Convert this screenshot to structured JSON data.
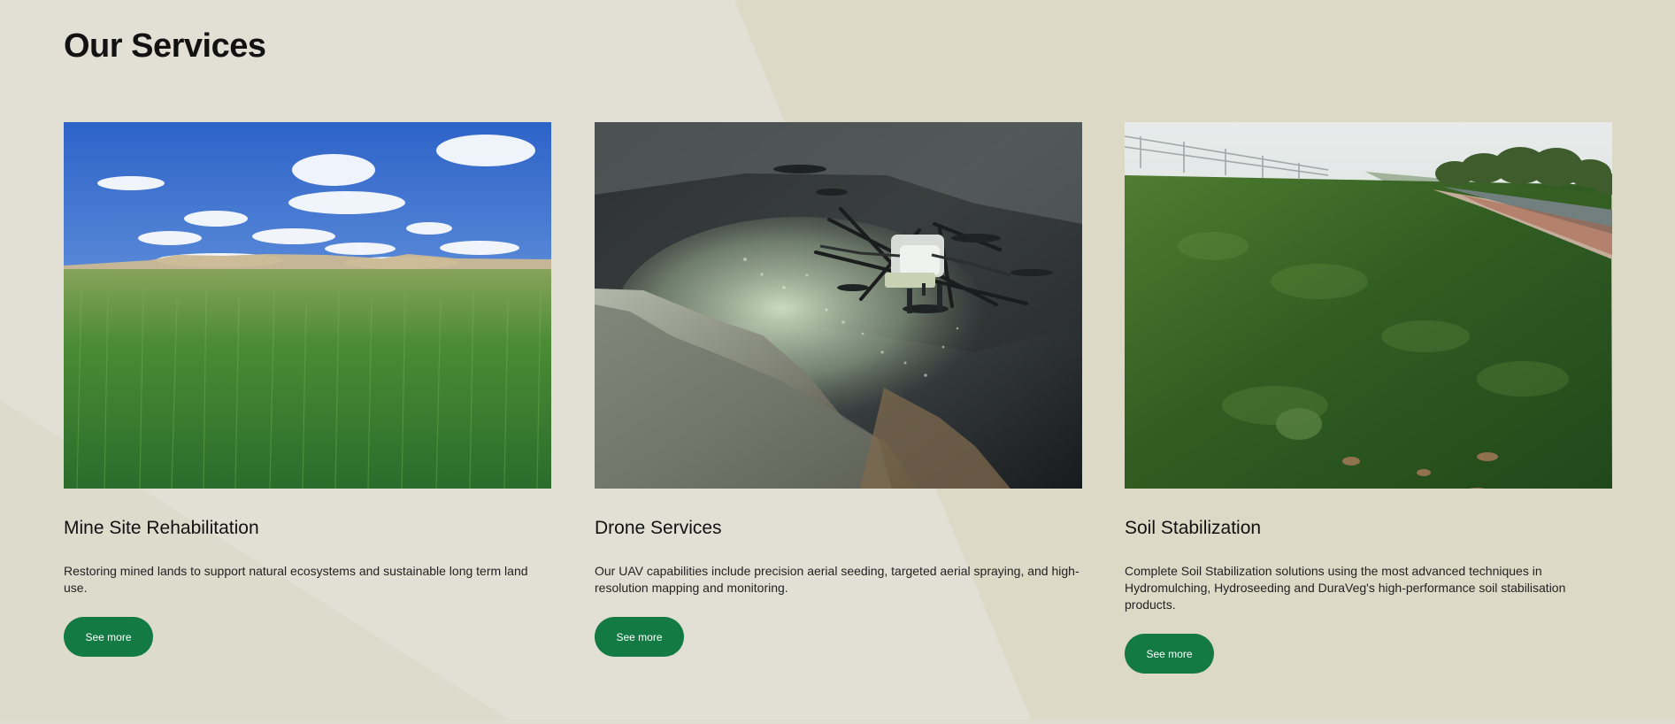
{
  "section": {
    "title": "Our Services"
  },
  "cards": [
    {
      "image_subject": "grassland-landscape-image",
      "title": "Mine Site Rehabilitation",
      "description": "Restoring mined lands to support natural ecosystems and sustainable long term land use.",
      "button_label": "See more"
    },
    {
      "image_subject": "drone-spraying-image",
      "title": "Drone Services",
      "description": "Our UAV capabilities include precision aerial seeding, targeted aerial spraying, and high-resolution mapping and monitoring.",
      "button_label": "See more"
    },
    {
      "image_subject": "soil-stabilization-slope-image",
      "title": "Soil Stabilization",
      "description": "Complete Soil Stabilization solutions using the most advanced techniques in Hydromulching, Hydroseeding and DuraVeg's high-performance soil stabilisation products.",
      "button_label": "See more"
    }
  ],
  "colors": {
    "background": "#dfddd0",
    "button": "#137a43",
    "button_text": "#ffffff",
    "heading": "#121212"
  }
}
